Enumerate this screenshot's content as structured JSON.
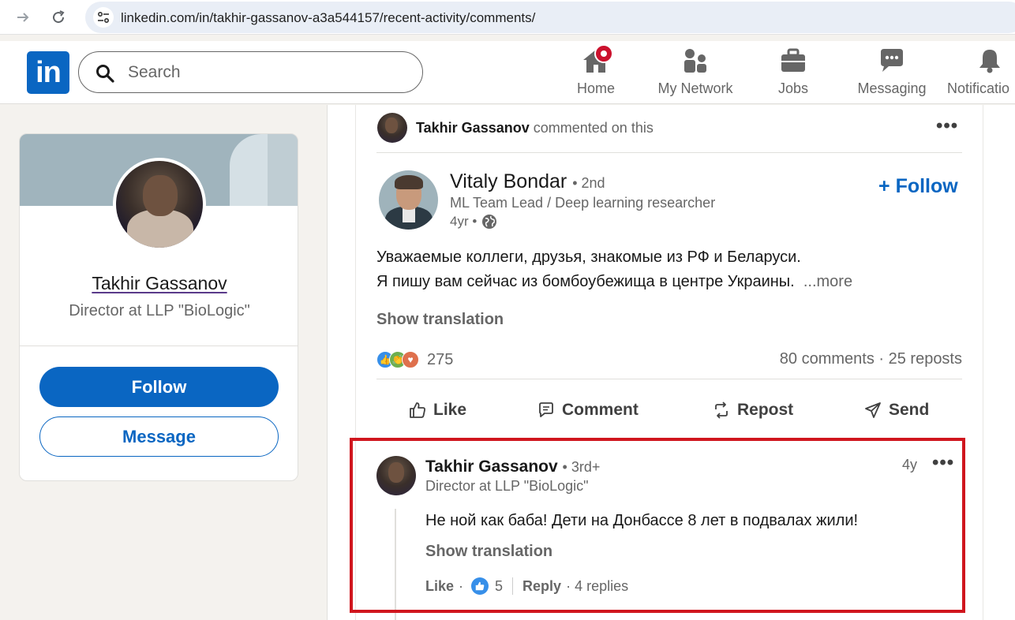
{
  "browser": {
    "url": "linkedin.com/in/takhir-gassanov-a3a544157/recent-activity/comments/"
  },
  "header": {
    "logo": "in",
    "search_placeholder": "Search",
    "nav": [
      {
        "label": "Home",
        "icon": "home-icon"
      },
      {
        "label": "My Network",
        "icon": "network-icon"
      },
      {
        "label": "Jobs",
        "icon": "briefcase-icon"
      },
      {
        "label": "Messaging",
        "icon": "messaging-icon"
      },
      {
        "label": "Notificatio",
        "icon": "bell-icon"
      }
    ]
  },
  "profile": {
    "name": "Takhir Gassanov",
    "title": "Director at LLP \"BioLogic\"",
    "follow_label": "Follow",
    "message_label": "Message"
  },
  "post": {
    "actor_name": "Takhir Gassanov",
    "actor_action": "commented on this",
    "author_name": "Vitaly Bondar",
    "author_degree": "• 2nd",
    "author_headline": "ML Team Lead / Deep learning researcher",
    "time": "4yr •",
    "follow_label": "Follow",
    "body_line1": "Уважаемые коллеги, друзья, знакомые из РФ и Беларуси.",
    "body_line2": "Я пишу вам сейчас из бомбоубежища в центре Украины.",
    "more_label": "...more",
    "show_translation": "Show translation",
    "reaction_count": "275",
    "social_counts": "80 comments · 25 reposts",
    "actions": {
      "like": "Like",
      "comment": "Comment",
      "repost": "Repost",
      "send": "Send"
    }
  },
  "comment": {
    "name": "Takhir Gassanov",
    "degree": "• 3rd+",
    "headline": "Director at LLP \"BioLogic\"",
    "time": "4y",
    "text": "Не ной как баба! Дети на Донбассе 8 лет в подвалах жили!",
    "show_translation": "Show translation",
    "like_label": "Like",
    "like_sep": "·",
    "like_count": "5",
    "reply_label": "Reply",
    "replies": "· 4 replies"
  },
  "colors": {
    "brand": "#0a66c2",
    "highlight": "#d0161e",
    "notification": "#cb112d"
  }
}
